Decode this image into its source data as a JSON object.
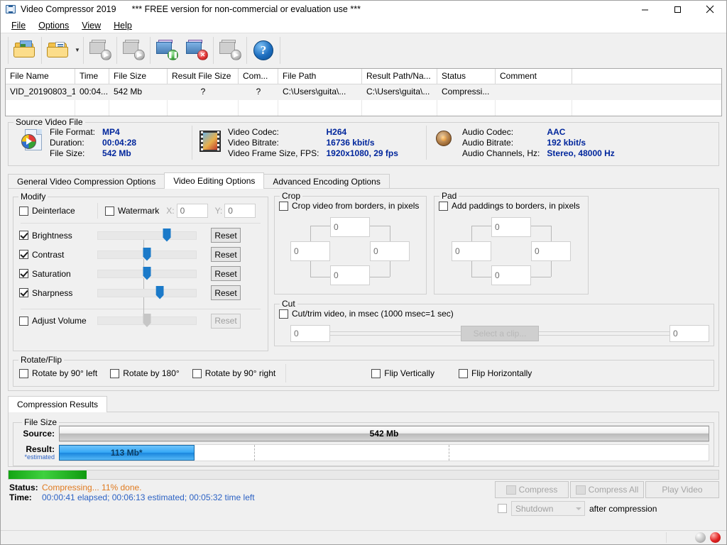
{
  "window": {
    "title": "Video Compressor 2019",
    "banner": "*** FREE version for non-commercial or evaluation use ***",
    "icon": "video-compressor-icon",
    "buttons": {
      "minimize": "—",
      "maximize": "❐",
      "close": "✕"
    }
  },
  "menu": {
    "items": [
      "File",
      "Options",
      "View",
      "Help"
    ]
  },
  "toolbar": {
    "items": [
      {
        "name": "open-file-icon",
        "label": "Open File",
        "enabled": true
      },
      {
        "name": "open-folder-icon",
        "label": "Open Folder",
        "enabled": true,
        "dropdown": true
      },
      {
        "name": "compress-icon",
        "label": "Compress",
        "enabled": false
      },
      {
        "name": "compress-all-icon",
        "label": "Compress All",
        "enabled": false
      },
      {
        "name": "pause-icon",
        "label": "Pause",
        "enabled": true
      },
      {
        "name": "stop-icon",
        "label": "Stop",
        "enabled": true
      },
      {
        "name": "play-video-icon",
        "label": "Play Video",
        "enabled": false
      },
      {
        "name": "help-icon",
        "label": "Help",
        "enabled": true
      }
    ]
  },
  "file_list": {
    "columns": [
      "File Name",
      "Time",
      "File Size",
      "Result File Size",
      "Com...",
      "File Path",
      "Result Path/Na...",
      "Status",
      "Comment"
    ],
    "rows": [
      {
        "file_name": "VID_20190803_1...",
        "time": "00:04...",
        "file_size": "542 Mb",
        "result_file_size": "?",
        "compression": "?",
        "file_path": "C:\\Users\\guita\\...",
        "result_path": "C:\\Users\\guita\\...",
        "status": "Compressi...",
        "comment": ""
      }
    ]
  },
  "source_video": {
    "legend": "Source Video File",
    "sections": [
      {
        "icon": "media-file-icon",
        "fields": [
          {
            "label": "File Format:",
            "value": "MP4"
          },
          {
            "label": "Duration:",
            "value": "00:04:28"
          },
          {
            "label": "File Size:",
            "value": "542 Mb"
          }
        ]
      },
      {
        "icon": "video-strip-icon",
        "fields": [
          {
            "label": "Video Codec:",
            "value": "H264"
          },
          {
            "label": "Video Bitrate:",
            "value": "16736 kbit/s"
          },
          {
            "label": "Video Frame Size, FPS:",
            "value": "1920x1080, 29 fps"
          }
        ]
      },
      {
        "icon": "speaker-icon",
        "fields": [
          {
            "label": "Audio Codec:",
            "value": "AAC"
          },
          {
            "label": "Audio Bitrate:",
            "value": "192 kbit/s"
          },
          {
            "label": "Audio Channels, Hz:",
            "value": "Stereo, 48000 Hz"
          }
        ]
      }
    ]
  },
  "tabs": {
    "items": [
      {
        "label": "General Video Compression Options",
        "active": false
      },
      {
        "label": "Video Editing Options",
        "active": true
      },
      {
        "label": "Advanced Encoding Options",
        "active": false
      }
    ]
  },
  "modify": {
    "legend": "Modify",
    "deinterlace": {
      "label": "Deinterlace",
      "checked": false
    },
    "watermark": {
      "label": "Watermark",
      "checked": false
    },
    "watermark_x": {
      "label": "X:",
      "value": "0",
      "enabled": false
    },
    "watermark_y": {
      "label": "Y:",
      "value": "0",
      "enabled": false
    },
    "sliders": [
      {
        "label": "Brightness",
        "checked": true,
        "position": 70,
        "reset_label": "Reset",
        "enabled": true
      },
      {
        "label": "Contrast",
        "checked": true,
        "position": 50,
        "reset_label": "Reset",
        "enabled": true
      },
      {
        "label": "Saturation",
        "checked": true,
        "position": 50,
        "reset_label": "Reset",
        "enabled": true
      },
      {
        "label": "Sharpness",
        "checked": true,
        "position": 63,
        "reset_label": "Reset",
        "enabled": true
      }
    ],
    "volume": {
      "label": "Adjust Volume",
      "checked": false,
      "position": 50,
      "reset_label": "Reset",
      "enabled": false
    }
  },
  "crop": {
    "legend": "Crop",
    "checkbox_label": "Crop video from borders, in pixels",
    "checked": false,
    "top": "0",
    "left": "0",
    "right": "0",
    "bottom": "0"
  },
  "pad": {
    "legend": "Pad",
    "checkbox_label": "Add paddings to borders, in pixels",
    "checked": false,
    "top": "0",
    "left": "0",
    "right": "0",
    "bottom": "0"
  },
  "cut": {
    "legend": "Cut",
    "checkbox_label": "Cut/trim video, in msec (1000 msec=1 sec)",
    "checked": false,
    "start": "0",
    "end": "0",
    "select_clip_label": "Select a clip...",
    "select_clip_enabled": false
  },
  "rotate_flip": {
    "legend": "Rotate/Flip",
    "options": [
      {
        "label": "Rotate by 90° left",
        "checked": false
      },
      {
        "label": "Rotate by 180°",
        "checked": false
      },
      {
        "label": "Rotate by 90° right",
        "checked": false
      }
    ],
    "flips": [
      {
        "label": "Flip Vertically",
        "checked": false
      },
      {
        "label": "Flip Horizontally",
        "checked": false
      }
    ]
  },
  "results": {
    "tab_label": "Compression Results",
    "legend": "File Size",
    "source": {
      "label": "Source:",
      "value": "542 Mb",
      "percent": 100
    },
    "result": {
      "label": "Result:",
      "value": "113 Mb*",
      "percent": 20.8,
      "note": "*estimated"
    }
  },
  "progress": {
    "percent": 11
  },
  "status": {
    "status_key": "Status:",
    "status_value": "Compressing... 11% done.",
    "time_key": "Time:",
    "time_value": "00:00:41 elapsed;  00:06:13 estimated;  00:05:32 time left"
  },
  "actions": {
    "compress": {
      "label": "Compress",
      "enabled": false
    },
    "compress_all": {
      "label": "Compress All",
      "enabled": false
    },
    "play_video": {
      "label": "Play Video",
      "enabled": false
    },
    "shutdown": {
      "label": "Shutdown",
      "checked": false,
      "enabled": false
    },
    "after_compression": "after compression"
  },
  "statusbar": {
    "indicators": [
      "idle-indicator",
      "recording-indicator"
    ]
  },
  "colors": {
    "value_blue": "#00269c",
    "status_orange": "#e07b20",
    "time_blue": "#2c62c4",
    "slider_blue": "#1b7ac9",
    "progress_green": "#3fd13f",
    "result_bar_blue": "#36a8f5"
  }
}
